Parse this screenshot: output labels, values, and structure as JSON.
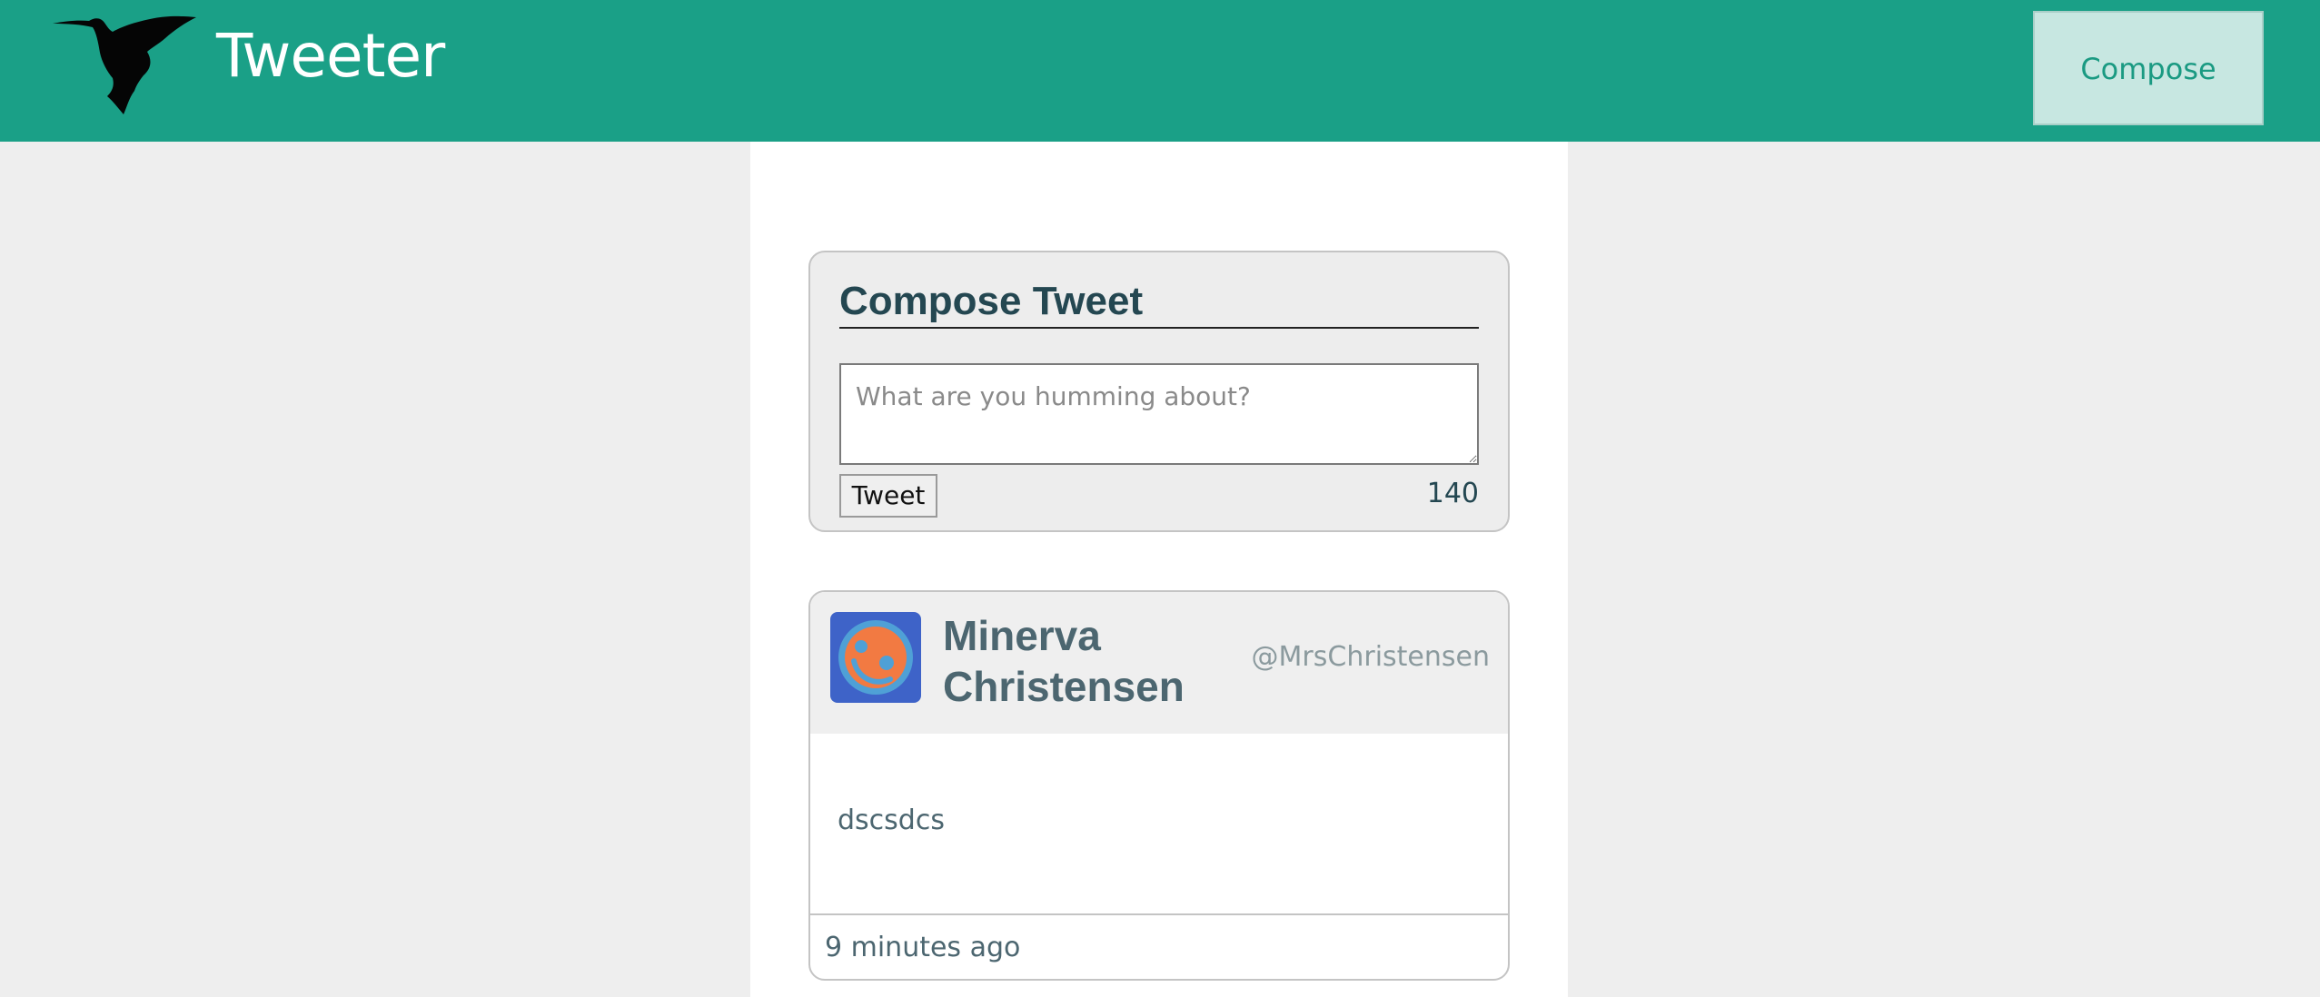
{
  "navbar": {
    "brand": "Tweeter",
    "compose_label": "Compose",
    "logo_icon": "hummingbird-icon",
    "colors": {
      "background": "#1aa087",
      "compose_bg": "#c7e7e1",
      "compose_text": "#1a9a82"
    }
  },
  "compose": {
    "title": "Compose Tweet",
    "placeholder": "What are you humming about?",
    "value": "",
    "tweet_label": "Tweet",
    "counter": "140"
  },
  "tweets": [
    {
      "name": "Minerva Christensen",
      "handle": "@MrsChristensen",
      "content": "dscsdcs",
      "time": "9 minutes ago",
      "avatar_icon": "avatar-face-icon"
    }
  ]
}
